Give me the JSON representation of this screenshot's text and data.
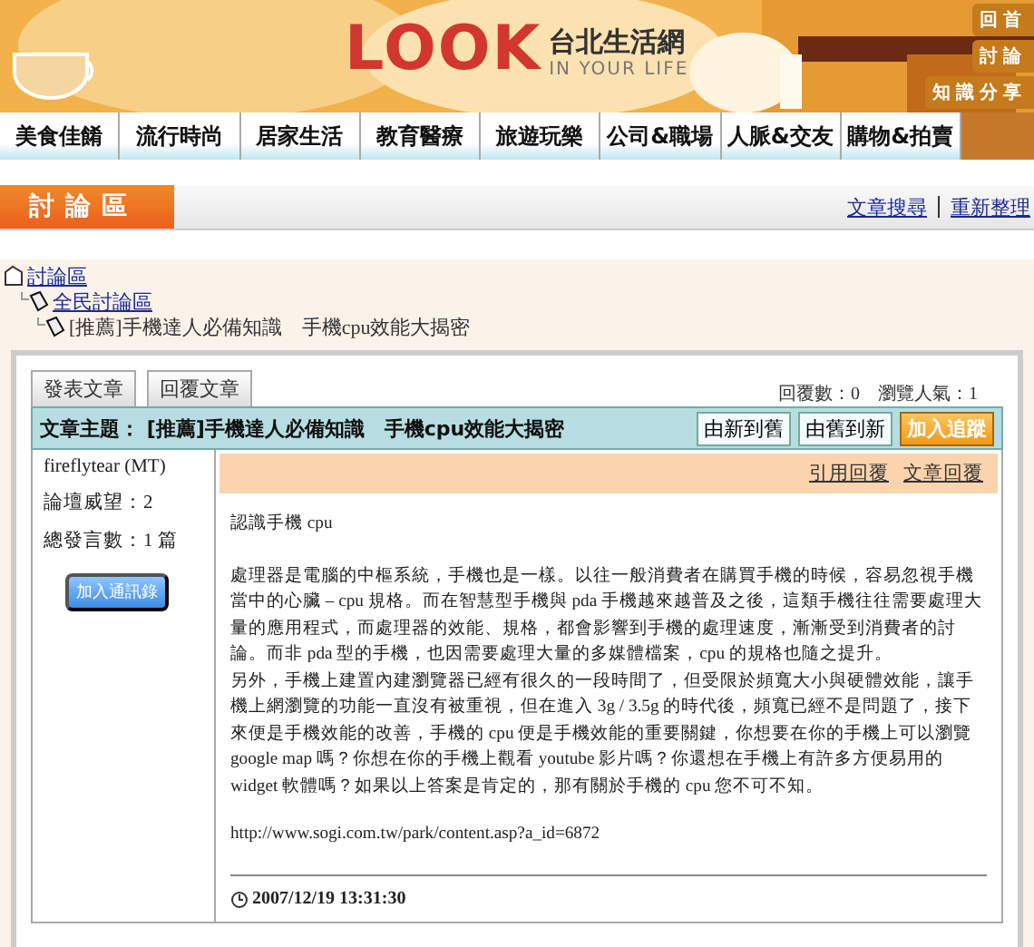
{
  "header": {
    "logo": "LOOK",
    "site_name": "台北生活網",
    "tagline": "IN YOUR LIFE",
    "quick_links": [
      "回首",
      "討論",
      "知識分享"
    ]
  },
  "nav": [
    "美食佳餚",
    "流行時尚",
    "居家生活",
    "教育醫療",
    "旅遊玩樂",
    "公司&職場",
    "人脈&交友",
    "購物&拍賣"
  ],
  "section": {
    "title": "討論區",
    "links": [
      "文章搜尋",
      "重新整理"
    ]
  },
  "breadcrumbs": [
    {
      "label": "討論區",
      "link": true,
      "children": [
        {
          "label": "全民討論區",
          "link": true,
          "children": [
            {
              "label": "[推薦]手機達人必備知識　手機cpu效能大揭密",
              "link": false
            }
          ]
        }
      ]
    }
  ],
  "post_tabs": [
    "發表文章",
    "回覆文章"
  ],
  "stats": [
    "回覆數：0",
    "瀏覽人氣：1"
  ],
  "topic": {
    "label": "文章主題：",
    "title": "[推薦]手機達人必備知識　手機cpu效能大揭密",
    "buttons": [
      {
        "label": "由新到舊",
        "kind": "plain"
      },
      {
        "label": "由舊到新",
        "kind": "plain"
      },
      {
        "label": "加入追蹤",
        "kind": "highlight"
      }
    ]
  },
  "author": {
    "name": "fireflytear (MT)",
    "lines": [
      "論壇威望：2",
      "總發言數：1 篇"
    ],
    "button": "加入通訊錄"
  },
  "post_actions": [
    "引用回覆",
    "文章回覆"
  ],
  "post": {
    "heading": "認識手機 cpu",
    "paragraphs": [
      "處理器是電腦的中樞系統，手機也是一樣。以往一般消費者在購買手機的時候，容易忽視手機當中的心臟 – cpu 規格。而在智慧型手機與 pda 手機越來越普及之後，這類手機往往需要處理大量的應用程式，而處理器的效能、規格，都會影響到手機的處理速度，漸漸受到消費者的討論。而非 pda 型的手機，也因需要處理大量的多媒體檔案，cpu 的規格也隨之提升。",
      "另外，手機上建置內建瀏覽器已經有很久的一段時間了，但受限於頻寬大小與硬體效能，讓手機上網瀏覽的功能一直沒有被重視，但在進入 3g / 3.5g 的時代後，頻寬已經不是問題了，接下來便是手機效能的改善，手機的 cpu 便是手機效能的重要關鍵，你想要在你的手機上可以瀏覽 google map 嗎？你想在你的手機上觀看 youtube 影片嗎？你還想在手機上有許多方便易用的 widget 軟體嗎？如果以上答案是肯定的，那有關於手機的 cpu 您不可不知。"
    ],
    "source": "http://www.sogi.com.tw/park/content.asp?a_id=6872",
    "time": "2007/12/19 13:31:30"
  }
}
